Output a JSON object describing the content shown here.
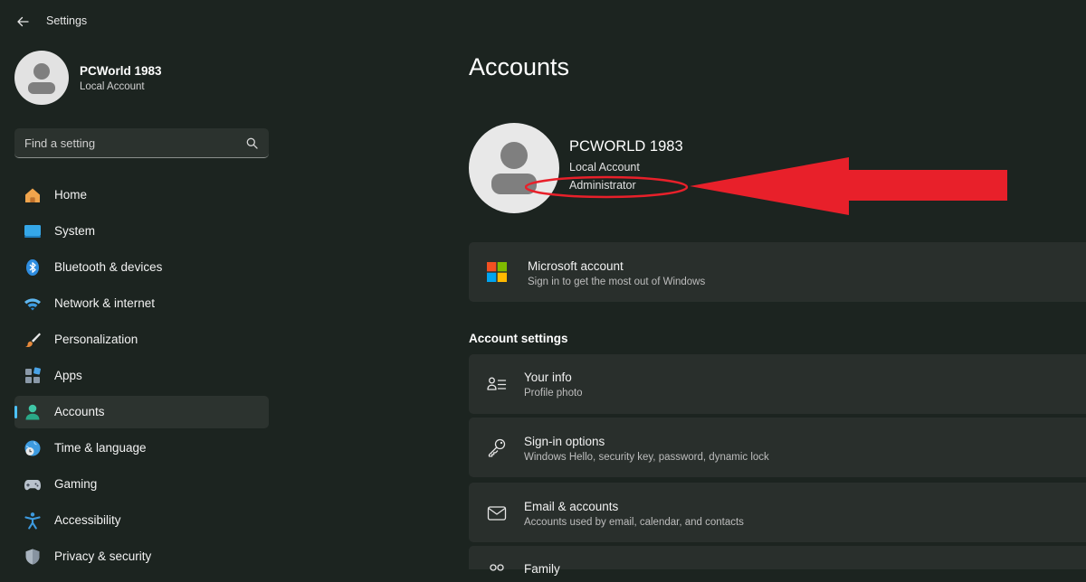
{
  "window": {
    "title": "Settings"
  },
  "profile": {
    "name": "PCWorld 1983",
    "type": "Local Account"
  },
  "search": {
    "placeholder": "Find a setting"
  },
  "nav": {
    "items": [
      {
        "label": "Home",
        "icon": "home-icon"
      },
      {
        "label": "System",
        "icon": "system-icon"
      },
      {
        "label": "Bluetooth & devices",
        "icon": "bluetooth-icon"
      },
      {
        "label": "Network & internet",
        "icon": "wifi-icon"
      },
      {
        "label": "Personalization",
        "icon": "brush-icon"
      },
      {
        "label": "Apps",
        "icon": "apps-icon"
      },
      {
        "label": "Accounts",
        "icon": "accounts-icon",
        "selected": true
      },
      {
        "label": "Time & language",
        "icon": "globe-clock-icon"
      },
      {
        "label": "Gaming",
        "icon": "gamepad-icon"
      },
      {
        "label": "Accessibility",
        "icon": "accessibility-icon"
      },
      {
        "label": "Privacy & security",
        "icon": "shield-icon"
      }
    ]
  },
  "main": {
    "title": "Accounts",
    "account": {
      "name": "PCWORLD 1983",
      "type": "Local Account",
      "role": "Administrator"
    },
    "microsoft_card": {
      "title": "Microsoft account",
      "subtitle": "Sign in to get the most out of Windows",
      "icon": "microsoft-logo-icon"
    },
    "section_title": "Account settings",
    "settings": [
      {
        "title": "Your info",
        "subtitle": "Profile photo",
        "icon": "person-info-icon"
      },
      {
        "title": "Sign-in options",
        "subtitle": "Windows Hello, security key, password, dynamic lock",
        "icon": "key-icon"
      },
      {
        "title": "Email & accounts",
        "subtitle": "Accounts used by email, calendar, and contacts",
        "icon": "mail-icon"
      },
      {
        "title": "Family",
        "subtitle": "",
        "icon": "family-icon"
      }
    ]
  },
  "colors": {
    "background": "#1c2420",
    "card": "#292f2c",
    "accent": "#4cc2ff",
    "annotation": "#e8202a"
  }
}
